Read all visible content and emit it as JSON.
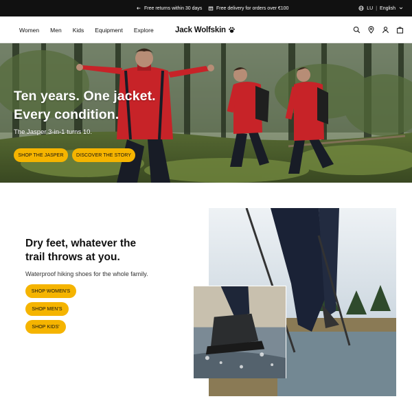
{
  "promo": {
    "returns": "Free returns within 30 days",
    "delivery": "Free delivery for orders over €100",
    "region": "LU",
    "language": "English"
  },
  "nav": {
    "items": [
      "Women",
      "Men",
      "Kids",
      "Equipment",
      "Explore"
    ]
  },
  "brand": {
    "name": "Jack Wolfskin"
  },
  "header_icons": [
    "search-icon",
    "location-pin-icon",
    "user-icon",
    "cart-icon"
  ],
  "hero": {
    "title_line1": "Ten years. One jacket.",
    "title_line2": "Every condition.",
    "subtitle": "The Jasper 3-in-1 turns 10.",
    "cta_primary": "SHOP THE JASPER",
    "cta_secondary": "DISCOVER THE STORY"
  },
  "feature": {
    "title_line1": "Dry feet, whatever the",
    "title_line2": "trail throws at you.",
    "subtitle": "Waterproof hiking shoes for the whole family.",
    "cta_women": "SHOP WOMEN'S",
    "cta_men": "SHOP MEN'S",
    "cta_kids": "SHOP KIDS'"
  },
  "colors": {
    "accent": "#f5b400",
    "topbar": "#111111",
    "jacket_red": "#d8262c"
  }
}
